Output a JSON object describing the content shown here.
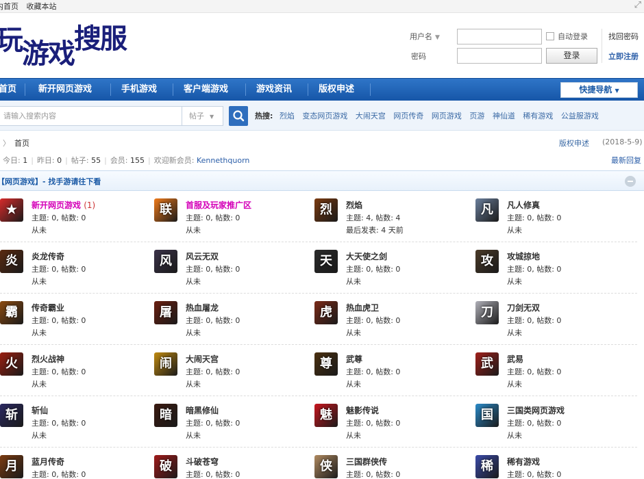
{
  "topbar": {
    "links": [
      "内首页",
      "收藏本站"
    ]
  },
  "logo": {
    "chars": [
      "玩",
      "游",
      "戏",
      "搜",
      "服"
    ]
  },
  "login": {
    "username_label": "用户名",
    "password_label": "密码",
    "auto_login": "自动登录",
    "login_button": "登录",
    "find_password": "找回密码",
    "register": "立即注册"
  },
  "nav": {
    "items": [
      "首页",
      "新开网页游戏",
      "手机游戏",
      "客户端游戏",
      "游戏资讯",
      "版权申述"
    ],
    "quick": "快捷导航"
  },
  "search": {
    "placeholder": "请输入搜索内容",
    "type": "帖子",
    "hot_label": "热搜:",
    "hot": [
      "烈焰",
      "变态网页游戏",
      "大闹天宫",
      "网页传奇",
      "网页游戏",
      "页游",
      "神仙道",
      "稀有游戏",
      "公益服游戏"
    ]
  },
  "breadcrumb": {
    "home": "首页",
    "copyright": "版权申述",
    "date": "(2018-5-9)"
  },
  "stats": {
    "today_label": "今日:",
    "today": "1",
    "yesterday_label": "昨日:",
    "yesterday": "0",
    "posts_label": "帖子:",
    "posts": "55",
    "members_label": "会员:",
    "members": "155",
    "welcome_label": "欢迎新会员:",
    "newest": "Kennethquorn",
    "latest": "最新回复"
  },
  "category": {
    "title": "【网页游戏】- 找手游请往下看"
  },
  "forums": [
    {
      "name": "新开网页游戏",
      "count": "(1)",
      "meta": "主题: 0, 帖数: 0",
      "last": "从未",
      "icon": "mario-icon",
      "color": "#d62b2b",
      "glyph": "★",
      "hl": true
    },
    {
      "name": "首服及玩家推广区",
      "count": "",
      "meta": "主题: 0, 帖数: 0",
      "last": "从未",
      "icon": "union-icon",
      "color": "#ef7a1a",
      "glyph": "联",
      "hl": true
    },
    {
      "name": "烈焰",
      "count": "",
      "meta": "主题: 4, 帖数: 4",
      "last": "最后发表: 4 天前",
      "icon": "game-icon",
      "color": "#7a3a10",
      "glyph": "烈"
    },
    {
      "name": "凡人修真",
      "count": "",
      "meta": "主题: 0, 帖数: 0",
      "last": "从未",
      "icon": "game-icon",
      "color": "#6b7f9c",
      "glyph": "凡"
    },
    {
      "name": "炎龙传奇",
      "count": "",
      "meta": "主题: 0, 帖数: 0",
      "last": "从未",
      "icon": "game-icon",
      "color": "#5a2a10",
      "glyph": "炎"
    },
    {
      "name": "风云无双",
      "count": "",
      "meta": "主题: 0, 帖数: 0",
      "last": "从未",
      "icon": "game-icon",
      "color": "#3a3248",
      "glyph": "风"
    },
    {
      "name": "大天使之剑",
      "count": "",
      "meta": "主题: 0, 帖数: 0",
      "last": "从未",
      "icon": "game-icon",
      "color": "#2a2a2a",
      "glyph": "天"
    },
    {
      "name": "攻城掠地",
      "count": "",
      "meta": "主题: 0, 帖数: 0",
      "last": "从未",
      "icon": "game-icon",
      "color": "#4a3a28",
      "glyph": "攻"
    },
    {
      "name": "传奇霸业",
      "count": "",
      "meta": "主题: 0, 帖数: 0",
      "last": "从未",
      "icon": "game-icon",
      "color": "#8a4a10",
      "glyph": "霸"
    },
    {
      "name": "热血屠龙",
      "count": "",
      "meta": "主题: 0, 帖数: 0",
      "last": "从未",
      "icon": "game-icon",
      "color": "#6a1f10",
      "glyph": "屠"
    },
    {
      "name": "热血虎卫",
      "count": "",
      "meta": "主题: 0, 帖数: 0",
      "last": "从未",
      "icon": "game-icon",
      "color": "#7a2a18",
      "glyph": "虎"
    },
    {
      "name": "刀剑无双",
      "count": "",
      "meta": "主题: 0, 帖数: 0",
      "last": "从未",
      "icon": "game-icon",
      "color": "#b0b0b8",
      "glyph": "刀"
    },
    {
      "name": "烈火战神",
      "count": "",
      "meta": "主题: 0, 帖数: 0",
      "last": "从未",
      "icon": "game-icon",
      "color": "#9a1f10",
      "glyph": "火"
    },
    {
      "name": "大闹天宫",
      "count": "",
      "meta": "主题: 0, 帖数: 0",
      "last": "从未",
      "icon": "game-icon",
      "color": "#c08a10",
      "glyph": "闹"
    },
    {
      "name": "武尊",
      "count": "",
      "meta": "主题: 0, 帖数: 0",
      "last": "从未",
      "icon": "game-icon",
      "color": "#4a3010",
      "glyph": "尊"
    },
    {
      "name": "武易",
      "count": "",
      "meta": "主题: 0, 帖数: 0",
      "last": "从未",
      "icon": "game-icon",
      "color": "#a0201a",
      "glyph": "武"
    },
    {
      "name": "斩仙",
      "count": "",
      "meta": "主题: 0, 帖数: 0",
      "last": "从未",
      "icon": "game-icon",
      "color": "#2a2860",
      "glyph": "斩"
    },
    {
      "name": "暗黑修仙",
      "count": "",
      "meta": "主题: 0, 帖数: 0",
      "last": "从未",
      "icon": "game-icon",
      "color": "#3a1a10",
      "glyph": "暗"
    },
    {
      "name": "魅影传说",
      "count": "",
      "meta": "主题: 0, 帖数: 0",
      "last": "从未",
      "icon": "game-icon",
      "color": "#c8161e",
      "glyph": "魅"
    },
    {
      "name": "三国类网页游戏",
      "count": "",
      "meta": "主题: 0, 帖数: 0",
      "last": "从未",
      "icon": "game-icon",
      "color": "#2a8ac8",
      "glyph": "国"
    },
    {
      "name": "蓝月传奇",
      "count": "",
      "meta": "主题: 0, 帖数: 0",
      "last": "",
      "icon": "game-icon",
      "color": "#7a3a10",
      "glyph": "月"
    },
    {
      "name": "斗破苍穹",
      "count": "",
      "meta": "主题: 0, 帖数: 0",
      "last": "",
      "icon": "game-icon",
      "color": "#a01a1a",
      "glyph": "破"
    },
    {
      "name": "三国群侠传",
      "count": "",
      "meta": "主题: 0, 帖数: 0",
      "last": "",
      "icon": "game-icon",
      "color": "#b08a60",
      "glyph": "侠"
    },
    {
      "name": "稀有游戏",
      "count": "",
      "meta": "主题: 0, 帖数: 0",
      "last": "",
      "icon": "game-icon",
      "color": "#3a4aa8",
      "glyph": "稀"
    }
  ]
}
